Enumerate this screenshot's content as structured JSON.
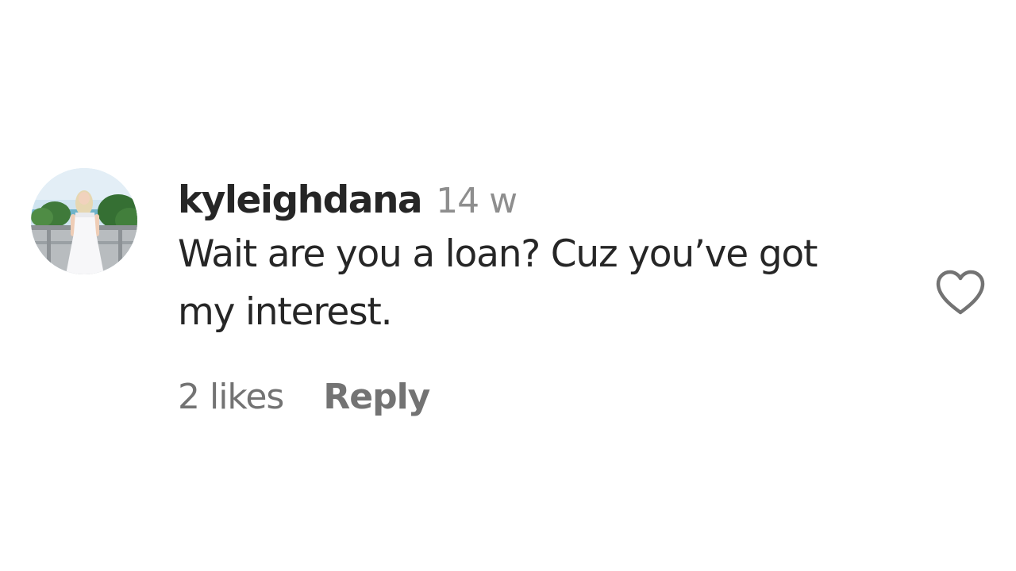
{
  "comment": {
    "username": "kyleighdana",
    "time": "14 w",
    "text": "Wait are you a loan? Cuz you’ve got my interest.",
    "likes": "2 likes",
    "reply_label": "Reply",
    "avatar_icon": "profile-photo",
    "like_icon": "heart-outline-icon"
  },
  "colors": {
    "primary_text": "#262626",
    "secondary_text": "#8e8e8e",
    "action_text": "#737373",
    "background": "#ffffff"
  }
}
